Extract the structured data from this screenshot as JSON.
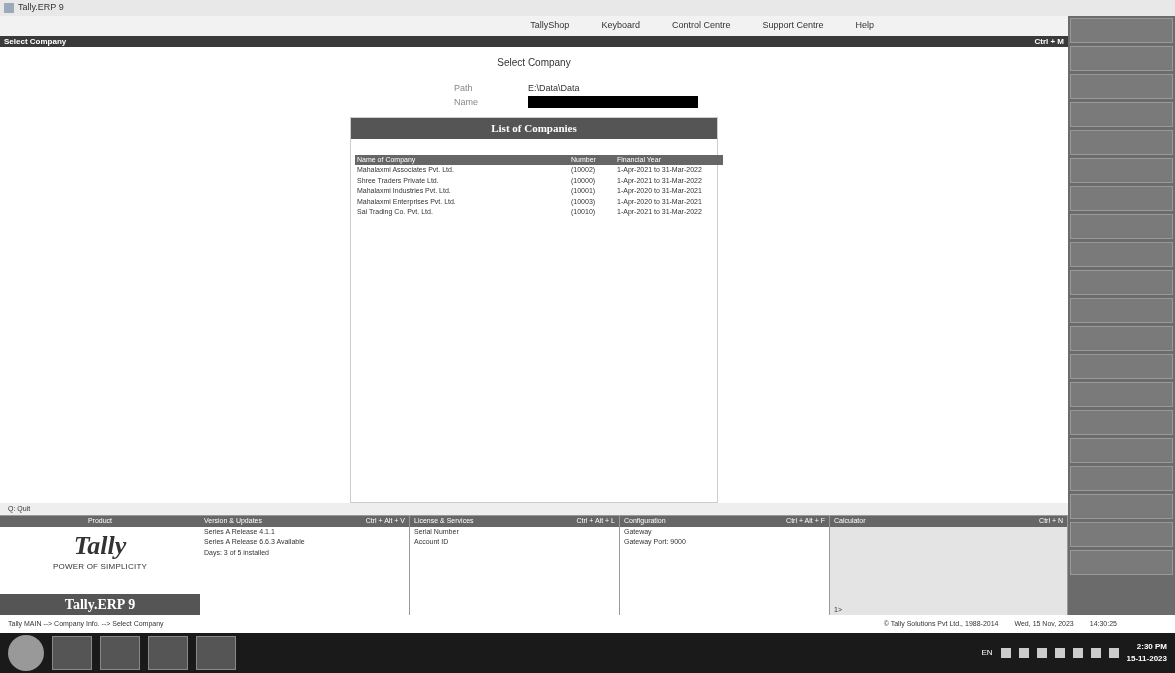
{
  "window": {
    "title": "Tally.ERP 9"
  },
  "menu": [
    "TallyShop",
    "Keyboard",
    "Control Centre",
    "Support Centre",
    "Help"
  ],
  "screen_title": "Select Company",
  "screen_shortcut": "Ctrl + M",
  "heading": "Select Company",
  "path": {
    "label": "Path",
    "value": "E:\\Data\\Data"
  },
  "name_field": {
    "label": "Name"
  },
  "list": {
    "title": "List of Companies",
    "columns": [
      "Name of Company",
      "Number",
      "Financial Year"
    ],
    "rows": [
      {
        "name": "Mahalaxmi Associates Pvt. Ltd.",
        "number": "(10002)",
        "period": "1-Apr-2021 to 31-Mar-2022"
      },
      {
        "name": "Shree Traders Private Ltd.",
        "number": "(10000)",
        "period": "1-Apr-2021 to 31-Mar-2022"
      },
      {
        "name": "Mahalaxmi Industries Pvt. Ltd.",
        "number": "(10001)",
        "period": "1-Apr-2020 to 31-Mar-2021"
      },
      {
        "name": "Mahalaxmi Enterprises Pvt. Ltd.",
        "number": "(10003)",
        "period": "1-Apr-2020 to 31-Mar-2021"
      },
      {
        "name": "Sai Trading Co. Pvt. Ltd.",
        "number": "(10010)",
        "period": "1-Apr-2021 to 31-Mar-2022"
      }
    ]
  },
  "quit": "Q: Quit",
  "panels": {
    "product": "Product",
    "brand": "Tally",
    "tagline": "POWER OF SIMPLICITY",
    "edition": "Tally.ERP 9",
    "version": {
      "title": "Version & Updates",
      "shortcut": "Ctrl + Alt + V",
      "lines": [
        "Series A Release 4.1.1",
        "Series A Release 6.6.3 Available",
        "Days: 3 of 5 installed"
      ]
    },
    "license": {
      "title": "License & Services",
      "shortcut": "Ctrl + Alt + L",
      "lines": [
        "Serial Number",
        "Account ID"
      ]
    },
    "config": {
      "title": "Configuration",
      "shortcut": "Ctrl + Alt + F",
      "lines": [
        "Gateway",
        "Gateway Port: 9000"
      ]
    },
    "calc": {
      "title": "Calculator",
      "shortcut": "Ctrl + N",
      "prompt": "1>"
    }
  },
  "status": {
    "breadcrumb": "Tally MAIN --> Company Info. --> Select Company",
    "copyright": "© Tally Solutions Pvt Ltd., 1988-2014",
    "date": "Wed, 15 Nov, 2023",
    "time": "14:30:25"
  },
  "taskbar": {
    "lang": "EN",
    "time": "2:30 PM",
    "date": "15-11-2023"
  }
}
